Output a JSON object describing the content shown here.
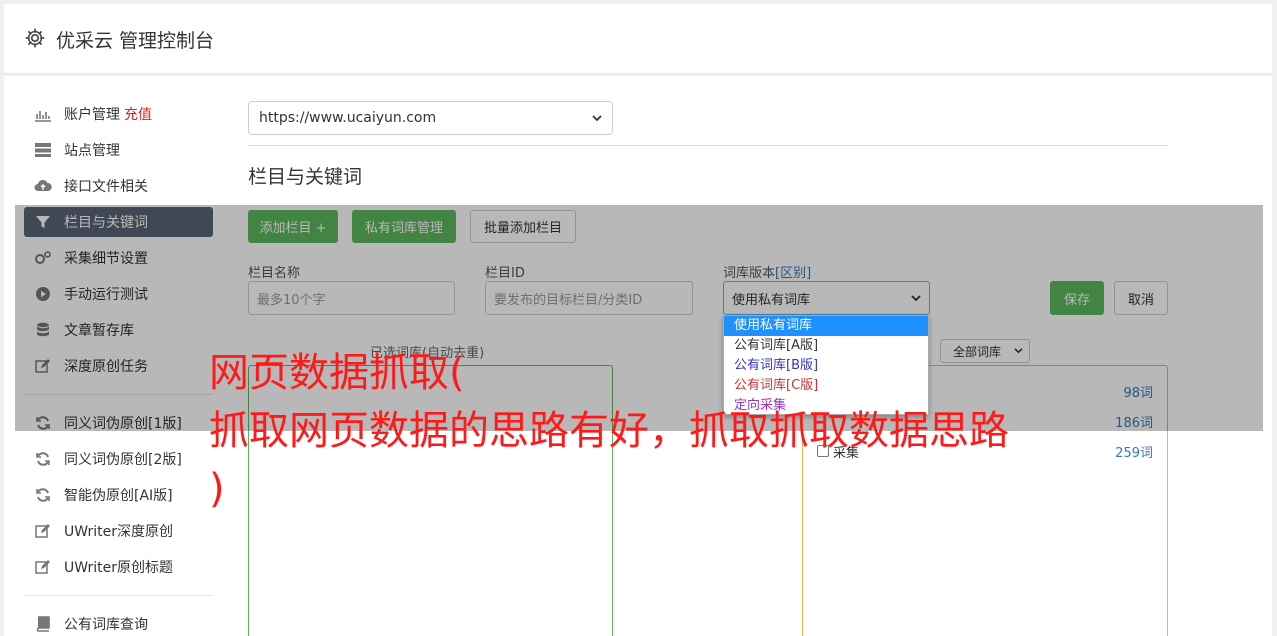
{
  "header": {
    "title": "优采云 管理控制台"
  },
  "sidebar": {
    "items": [
      {
        "label": "账户管理",
        "extra": "充值"
      },
      {
        "label": "站点管理"
      },
      {
        "label": "接口文件相关"
      },
      {
        "label": "栏目与关键词"
      },
      {
        "label": "采集细节设置"
      },
      {
        "label": "手动运行测试"
      },
      {
        "label": "文章暂存库"
      },
      {
        "label": "深度原创任务"
      },
      {
        "label": "同义词伪原创[1版]"
      },
      {
        "label": "同义词伪原创[2版]"
      },
      {
        "label": "智能伪原创[AI版]"
      },
      {
        "label": "UWriter深度原创"
      },
      {
        "label": "UWriter原创标题"
      },
      {
        "label": "公有词库查询"
      }
    ]
  },
  "main": {
    "site_select": "https://www.ucaiyun.com",
    "section_title": "栏目与关键词",
    "buttons": {
      "add_column": "添加栏目 +",
      "private_lib": "私有词库管理",
      "batch_add": "批量添加栏目",
      "save": "保存",
      "cancel": "取消"
    },
    "form": {
      "name_label": "栏目名称",
      "name_placeholder": "最多10个字",
      "id_label": "栏目ID",
      "id_placeholder": "要发布的目标栏目/分类ID",
      "version_label": "词库版本",
      "version_link": "[区别]",
      "version_value": "使用私有词库"
    },
    "dropdown_options": [
      "使用私有词库",
      "公有词库[A版]",
      "公有词库[B版]",
      "公有词库[C版]",
      "定向采集"
    ],
    "left_column_label": "已选词库(自动去重)",
    "lib_filter": "全部词库",
    "lib_rows": [
      {
        "name": "",
        "count": "98词"
      },
      {
        "name": "",
        "count": "186词"
      },
      {
        "name": "采集",
        "count": "259词"
      }
    ]
  },
  "banner": {
    "line1": "网页数据抓取(",
    "line2": "抓取网页数据的思路有好，抓取抓取数据思路",
    "line3": ")"
  },
  "colors": {
    "accent_green": "#5cb85c",
    "sidebar_active": "#5a6577",
    "banner_red": "#ff1a1a",
    "link_blue": "#337ab7"
  }
}
